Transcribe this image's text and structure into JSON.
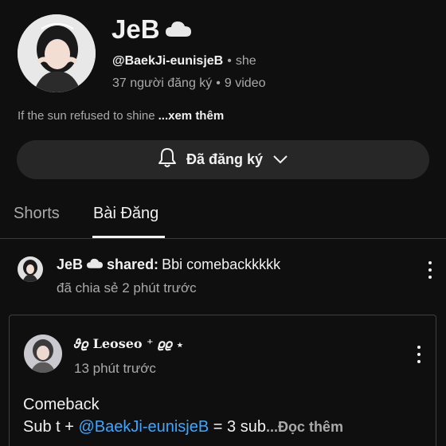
{
  "channel": {
    "name": "JeB",
    "name_emoji": "cloud-icon",
    "handle": "@BaekJi-eunisjeB",
    "separator": "•",
    "pronoun": "she",
    "subscribers": "37 người đăng ký",
    "videos": "9 video",
    "bio": "If the sun refused to shine",
    "bio_more": "...xem thêm"
  },
  "subscribe_button": {
    "label": "Đã đăng ký",
    "icon": "bell-icon",
    "chevron": "chevron-down-icon"
  },
  "tabs": [
    {
      "label": "Shorts",
      "active": false
    },
    {
      "label": "Bài Đăng",
      "active": true
    }
  ],
  "post": {
    "author": "JeB",
    "shared_prefix": "shared:",
    "shared_text": "Bbi comebackkkkk",
    "time": "đã chia sẻ 2 phút trước",
    "original": {
      "author": "𝜗𝜚 Leoseo ⁺ 𝜚𝜚 ⋆",
      "time": "13 phút trước",
      "line1": "Comeback",
      "line2_prefix": "Sub t + ",
      "mention": "@BaekJi-eunisjeB",
      "line2_suffix": " = 3 sub",
      "read_more": "...Đọc thêm"
    }
  },
  "colors": {
    "background": "#0f0f0f",
    "button_bg": "#272727",
    "secondary_text": "#aaaaaa",
    "link": "#3ea6ff"
  }
}
